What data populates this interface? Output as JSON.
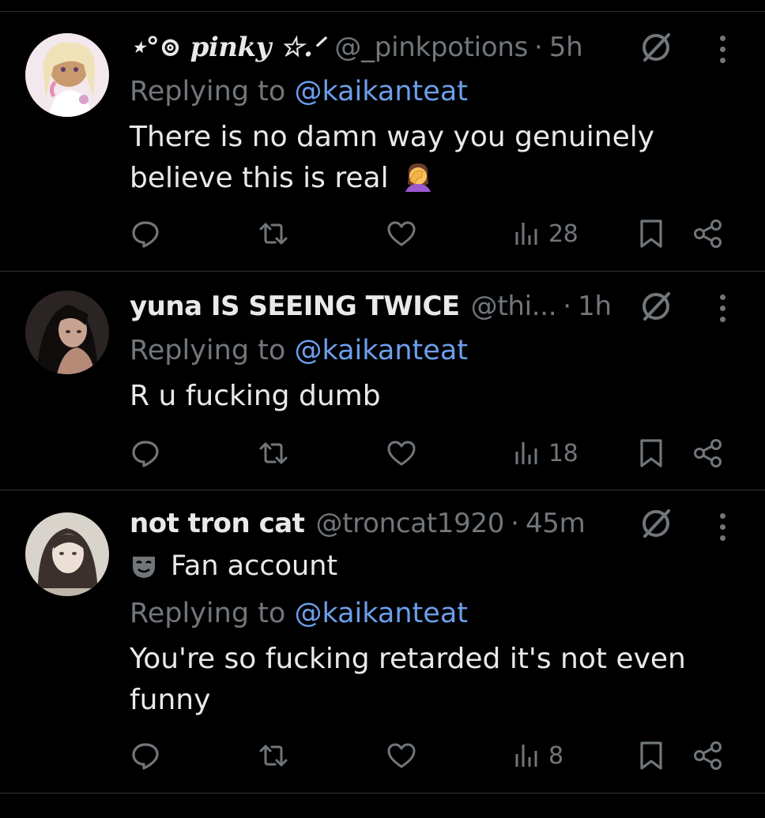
{
  "tweets": [
    {
      "display_name": "⋆°⊚ pinky ☆.ᐟ",
      "handle": "@_pinkpotions",
      "separator": "·",
      "time": "5h",
      "replying_prefix": "Replying to ",
      "replying_to": "@kaikanteat",
      "text": "There is no damn way you genuinely believe this is real",
      "emoji": "face-palm-emoji",
      "views": "28"
    },
    {
      "display_name": "yuna IS SEEING TWICE",
      "handle": "@thi...",
      "separator": "·",
      "time": "1h",
      "replying_prefix": "Replying to ",
      "replying_to": "@kaikanteat",
      "text": "R u fucking dumb",
      "views": "18"
    },
    {
      "display_name": "not tron cat",
      "handle": "@troncat1920",
      "separator": "·",
      "time": "45m",
      "label": "Fan account",
      "replying_prefix": "Replying to ",
      "replying_to": "@kaikanteat",
      "text": "You're so fucking retarded it's not even funny",
      "views": "8"
    }
  ],
  "icons": {
    "reply": "reply-icon",
    "retweet": "retweet-icon",
    "like": "like-icon",
    "views": "views-icon",
    "bookmark": "bookmark-icon",
    "share": "share-icon",
    "grok": "slash-circle-icon",
    "more": "more-icon",
    "fan": "mask-icon"
  },
  "colors": {
    "background": "#000000",
    "text": "#e7e9ea",
    "secondary": "#71767b",
    "mention": "#6d9eeb",
    "divider": "#2f3336"
  }
}
